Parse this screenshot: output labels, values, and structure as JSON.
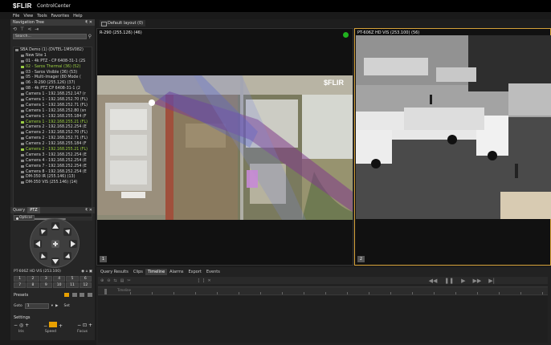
{
  "app": {
    "logo": "$FLIR",
    "name": "ControlCenter"
  },
  "menu": [
    "File",
    "View",
    "Tools",
    "Favorites",
    "Help"
  ],
  "nav_tree": {
    "title": "Navigation Tree",
    "controls": "₹ ✕",
    "search_placeholder": "Search...",
    "items": [
      {
        "label": "SBA Demo (1) (DVTEL-1MSV082)",
        "level": 0,
        "color": "normal"
      },
      {
        "label": "New Site 1",
        "level": 1,
        "color": "normal"
      },
      {
        "label": "01 - 4k PTZ - CP 6408-31-1 (2S",
        "level": 1,
        "color": "normal"
      },
      {
        "label": "02 - Saros Thermal (36) (52)",
        "level": 1,
        "color": "green"
      },
      {
        "label": "03 - Saros Visible (36) (53)",
        "level": 1,
        "color": "normal"
      },
      {
        "label": "05 - Multi-Imager (80 Mode (",
        "level": 1,
        "color": "normal"
      },
      {
        "label": "06 - R-290 (255.126) (37)",
        "level": 1,
        "color": "normal"
      },
      {
        "label": "08 - 4k PTZ CP 6408-31-1 (2",
        "level": 1,
        "color": "normal"
      },
      {
        "label": "Camera 1 - 192.168.252.147 (r",
        "level": 1,
        "color": "normal"
      },
      {
        "label": "Camera 1 - 192.168.252.70 (FL)",
        "level": 1,
        "color": "normal"
      },
      {
        "label": "Camera 1 - 192.168.252.71 (FL)",
        "level": 1,
        "color": "normal"
      },
      {
        "label": "Camera 1 - 192.168.252.80 (sn",
        "level": 1,
        "color": "normal"
      },
      {
        "label": "Camera 1 - 192.168.255.184 (F",
        "level": 1,
        "color": "normal"
      },
      {
        "label": "Camera 1 - 192.168.255.21 (FL)",
        "level": 1,
        "color": "green"
      },
      {
        "label": "Camera 2 - 192.168.252.254 (E",
        "level": 1,
        "color": "normal"
      },
      {
        "label": "Camera 2 - 192.168.252.70 (FL)",
        "level": 1,
        "color": "normal"
      },
      {
        "label": "Camera 2 - 192.168.252.71 (FL)",
        "level": 1,
        "color": "normal"
      },
      {
        "label": "Camera 2 - 192.168.255.184 (F",
        "level": 1,
        "color": "normal"
      },
      {
        "label": "Camera 2 - 192.168.255.21 (FL)",
        "level": 1,
        "color": "green"
      },
      {
        "label": "Camera 3 - 192.168.252.254 (E",
        "level": 1,
        "color": "normal"
      },
      {
        "label": "Camera 4 - 192.168.252.254 (E",
        "level": 1,
        "color": "normal"
      },
      {
        "label": "Camera 7 - 192.168.252.254 (E",
        "level": 1,
        "color": "normal"
      },
      {
        "label": "Camera 8 - 192.168.252.254 (E",
        "level": 1,
        "color": "normal"
      },
      {
        "label": "DM-350 IR (255.146) (13)",
        "level": 1,
        "color": "normal"
      },
      {
        "label": "DM-350 VIS (255.146) (14)",
        "level": 1,
        "color": "normal"
      }
    ]
  },
  "ptz": {
    "tabs": [
      "Query",
      "PTZ"
    ],
    "controls": "₹ ✕",
    "optical_label": "Optical",
    "camera_name": "PT-606Z HD VIS (253.100)",
    "keypad": [
      "1",
      "2",
      "3",
      "4",
      "5",
      "6",
      "7",
      "8",
      "9",
      "10",
      "11",
      "12"
    ],
    "presets_label": "Presets",
    "goto_label": "Goto",
    "goto_value": "1",
    "set_label": "Set",
    "settings_label": "Settings",
    "settings_labels": [
      "Iris",
      "Speed",
      "Focus"
    ]
  },
  "layout_tab": "Default layout (0)",
  "video": [
    {
      "title": "R-290 (255.126) (46)",
      "number": "1",
      "status_color": "#21b21f",
      "logo": "$FLIR"
    },
    {
      "title": "PT-606Z HD VIS (253.100) (56)",
      "number": "2"
    }
  ],
  "bottom": {
    "tabs": [
      "Query Results",
      "Clips",
      "Timeline",
      "Alarms",
      "Export",
      "Events"
    ],
    "active_tab": "Timeline",
    "ruler_label": "Timeline"
  }
}
